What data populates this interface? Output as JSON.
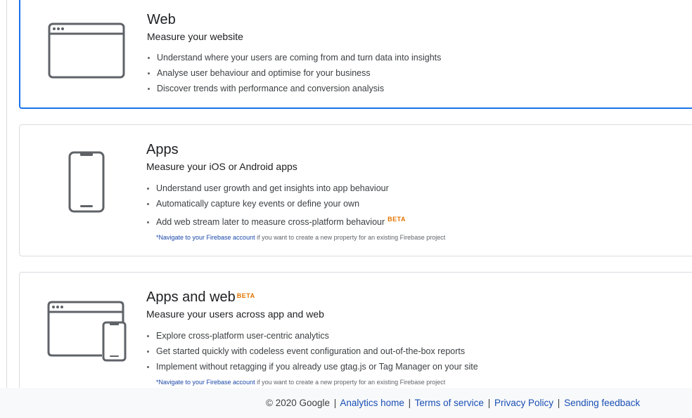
{
  "cards": {
    "web": {
      "title": "Web",
      "subtitle": "Measure your website",
      "bullets": [
        "Understand where your users are coming from and turn data into insights",
        "Analyse user behaviour and optimise for your business",
        "Discover trends with performance and conversion analysis"
      ],
      "icon": "browser-window-icon",
      "selected": true
    },
    "apps": {
      "title": "Apps",
      "subtitle": "Measure your iOS or Android apps",
      "bullets": [
        "Understand user growth and get insights into app behaviour",
        "Automatically capture key events or define your own",
        "Add web stream later to measure cross-platform behaviour"
      ],
      "bullet_badge": "BETA",
      "footnote_link": "*Navigate to your Firebase account",
      "footnote_text": " if you want to create a new property for an existing Firebase project",
      "icon": "smartphone-icon"
    },
    "apps_web": {
      "title": "Apps and web",
      "title_badge": "BETA",
      "subtitle": "Measure your users across app and web",
      "bullets": [
        "Explore cross-platform user-centric analytics",
        "Get started quickly with codeless event configuration and out-of-the-box reports",
        "Implement without retagging if you already use gtag.js or Tag Manager on your site"
      ],
      "footnote_link": "*Navigate to your Firebase account",
      "footnote_text": " if you want to create a new property for an existing Firebase project",
      "icon": "browser-and-phone-icon"
    }
  },
  "footer": {
    "copyright": "© 2020 Google",
    "separator": "|",
    "links": [
      "Analytics home",
      "Terms of service",
      "Privacy Policy",
      "Sending feedback"
    ]
  },
  "colors": {
    "accent": "#1a73e8",
    "beta": "#e37400",
    "link": "#1a4fb5",
    "icon": "#5f6368",
    "border": "#dadce0"
  }
}
